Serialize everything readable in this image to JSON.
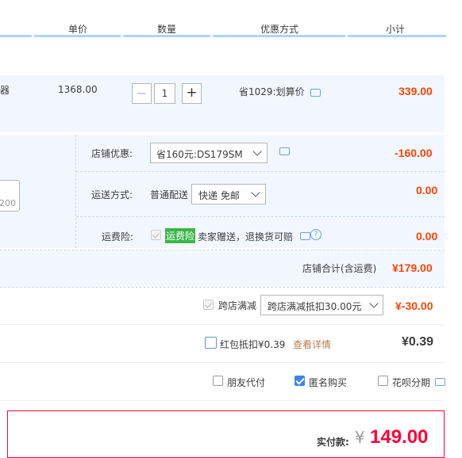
{
  "header": {
    "col_price": "单价",
    "col_qty": "数量",
    "col_discount": "优惠方式",
    "col_subtotal": "小计"
  },
  "item": {
    "title_fragment": "器",
    "unit_price": "1368.00",
    "qty_minus": "−",
    "qty_value": "1",
    "qty_plus": "+",
    "promo": "省1029:划算价",
    "subtotal": "339.00"
  },
  "shop": {
    "coupon_label": "店铺优惠:",
    "coupon_value": "省160元:DS179SM",
    "coupon_amount": "-160.00",
    "shipping_label": "运送方式:",
    "shipping_type": "普通配送",
    "shipping_value": "快递 免邮",
    "shipping_amount": "0.00",
    "insurance_label": "运费险:",
    "insurance_tag": "运费险",
    "insurance_desc": "卖家赠送，退换货可赔",
    "insurance_amount": "0.00",
    "left_box_value": "200",
    "total_label": "店铺合计(含运费)",
    "total_value": "¥179.00"
  },
  "cross_store": {
    "label": "跨店满减",
    "value": "跨店满减抵扣30.00元",
    "amount": "¥-30.00"
  },
  "redpacket": {
    "label": "红包抵扣¥0.39",
    "link": "查看详情",
    "amount": "¥0.39"
  },
  "options": {
    "friend_pay": "朋友代付",
    "anonymous": "匿名购买",
    "huabei": "花呗分期"
  },
  "payment": {
    "label": "实付款:",
    "currency": "¥",
    "amount": "149.00"
  },
  "colors": {
    "accent_red": "#ff0036",
    "price_red": "#ff4400",
    "header_line": "#b2d1ff",
    "row_bg": "#f2f7ff",
    "tag_green": "#3cb54a"
  }
}
